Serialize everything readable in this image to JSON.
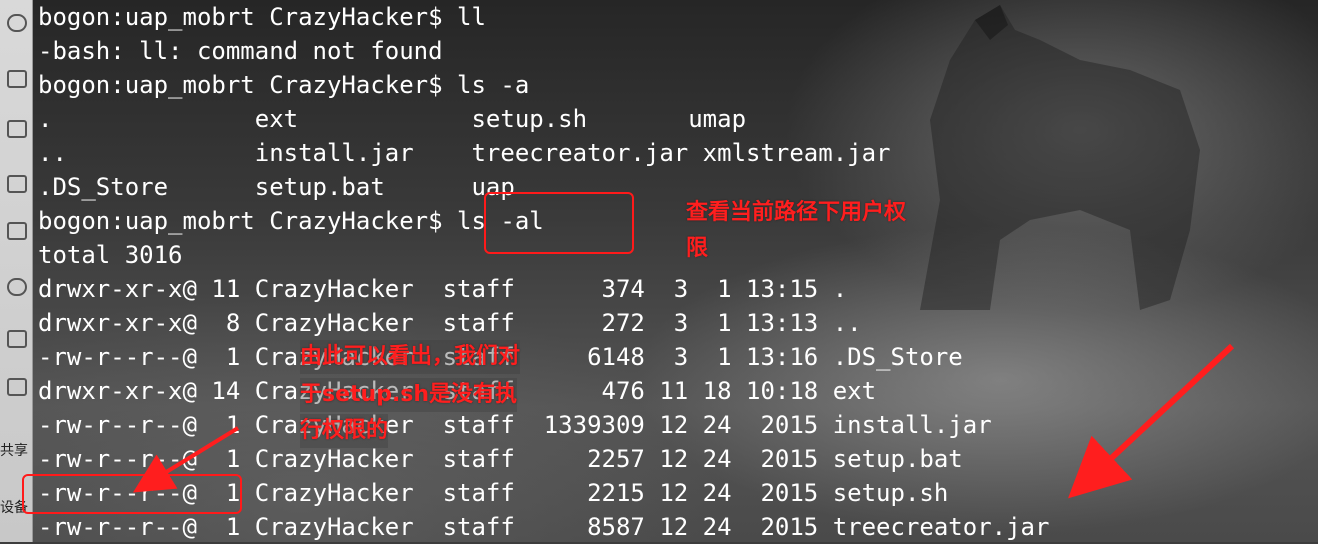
{
  "terminal": {
    "lines": [
      "bogon:uap_mobrt CrazyHacker$ ll",
      "-bash: ll: command not found",
      "bogon:uap_mobrt CrazyHacker$ ls -a",
      ".              ext            setup.sh       umap",
      "..             install.jar    treecreator.jar xmlstream.jar",
      ".DS_Store      setup.bat      uap",
      "bogon:uap_mobrt CrazyHacker$ ls -al",
      "total 3016",
      "drwxr-xr-x@ 11 CrazyHacker  staff      374  3  1 13:15 .",
      "drwxr-xr-x@  8 CrazyHacker  staff      272  3  1 13:13 ..",
      "-rw-r--r--@  1 CrazyHacker  staff     6148  3  1 13:16 .DS_Store",
      "drwxr-xr-x@ 14 CrazyHacker  staff      476 11 18 10:18 ext",
      "-rw-r--r--@  1 CrazyHacker  staff  1339309 12 24  2015 install.jar",
      "-rw-r--r--@  1 CrazyHacker  staff     2257 12 24  2015 setup.bat",
      "-rw-r--r--@  1 CrazyHacker  staff     2215 12 24  2015 setup.sh",
      "-rw-r--r--@  1 CrazyHacker  staff     8587 12 24  2015 treecreator.jar"
    ]
  },
  "annotations": {
    "permission_note_line1": "查看当前路径下用户权",
    "permission_note_line2": "限",
    "setup_note_line1": "由此可以看出，我们对",
    "setup_note_line2": "于setup.sh是没有执",
    "setup_note_line3": "行权限的",
    "accent_color": "#ff1e1e"
  },
  "sidebar": {
    "label_share": "共享",
    "label_device": "设备"
  }
}
